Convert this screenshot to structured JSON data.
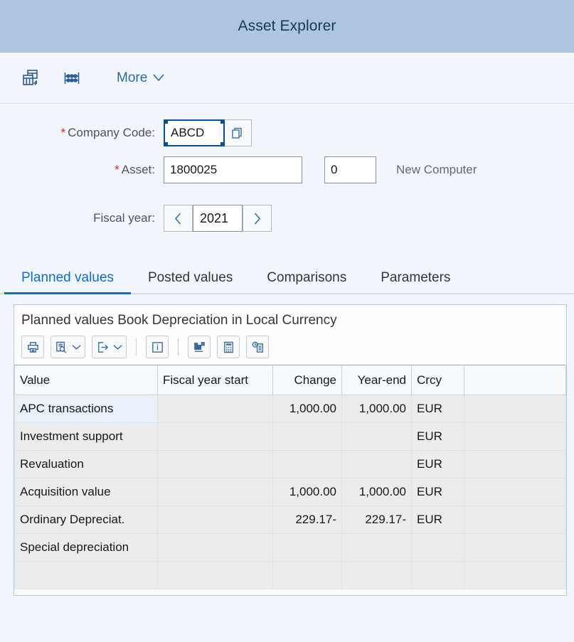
{
  "header": {
    "title": "Asset Explorer"
  },
  "toolbar": {
    "icons": [
      {
        "name": "asset-balance-icon",
        "title": "Asset Balances"
      },
      {
        "name": "abacus-depreciation-icon",
        "title": "Depreciation Calculation"
      }
    ],
    "more_label": "More",
    "more_chevron": "chevron-down-icon"
  },
  "form": {
    "company_code": {
      "label": "Company Code:",
      "required_marker": "*",
      "value": "ABCD",
      "placeholder": "",
      "value_help_icon": "copy-documents-icon"
    },
    "asset": {
      "label": "Asset:",
      "required_marker": "*",
      "value": "1800025",
      "placeholder": "",
      "subnumber_value": "0",
      "subnumber_placeholder": "",
      "description": "New Computer"
    },
    "fiscal_year": {
      "label": "Fiscal year:",
      "value": "2021",
      "placeholder": "",
      "prev_icon": "chevron-left-icon",
      "next_icon": "chevron-right-icon"
    }
  },
  "tabs": [
    {
      "label": "Planned values",
      "active": true
    },
    {
      "label": "Posted values",
      "active": false
    },
    {
      "label": "Comparisons",
      "active": false
    },
    {
      "label": "Parameters",
      "active": false
    }
  ],
  "panel": {
    "title": "Planned values Book Depreciation in Local Currency",
    "grid_toolbar": [
      {
        "name": "print-icon",
        "label": "",
        "has_dropdown": false
      },
      {
        "name": "view-settings-icon",
        "label": "",
        "has_dropdown": true
      },
      {
        "name": "export-icon",
        "label": "",
        "has_dropdown": true
      },
      {
        "name": "separator-1",
        "label": "",
        "has_dropdown": false
      },
      {
        "name": "info-icon",
        "label": "",
        "has_dropdown": false
      },
      {
        "name": "separator-2",
        "label": "",
        "has_dropdown": false
      },
      {
        "name": "chart-puzzle-icon",
        "label": "",
        "has_dropdown": false
      },
      {
        "name": "calculator-icon",
        "label": "",
        "has_dropdown": false
      },
      {
        "name": "history-list-icon",
        "label": "",
        "has_dropdown": false
      }
    ],
    "grid": {
      "columns": [
        {
          "key": "value",
          "label": "Value",
          "align": "left"
        },
        {
          "key": "fy_start",
          "label": "Fiscal year start",
          "align": "left"
        },
        {
          "key": "change",
          "label": "Change",
          "align": "right"
        },
        {
          "key": "year_end",
          "label": "Year-end",
          "align": "right"
        },
        {
          "key": "crcy",
          "label": "Crcy",
          "align": "left"
        }
      ],
      "rows": [
        {
          "value": "APC transactions",
          "fy_start": "",
          "change": "1,000.00",
          "year_end": "1,000.00",
          "crcy": "EUR",
          "highlight": "none",
          "year_end_highlight": "green",
          "first_row": true
        },
        {
          "value": "Investment support",
          "fy_start": "",
          "change": "",
          "year_end": "",
          "crcy": "EUR",
          "highlight": "none",
          "year_end_highlight": "green",
          "first_row": false
        },
        {
          "value": "Revaluation",
          "fy_start": "",
          "change": "",
          "year_end": "",
          "crcy": "EUR",
          "highlight": "none",
          "year_end_highlight": "green",
          "first_row": false
        },
        {
          "value": "Acquisition value",
          "fy_start": "",
          "change": "1,000.00",
          "year_end": "1,000.00",
          "crcy": "EUR",
          "highlight": "yellow",
          "year_end_highlight": "yellow",
          "first_row": false
        },
        {
          "value": "Ordinary Depreciat.",
          "fy_start": "",
          "change": "229.17-",
          "year_end": "229.17-",
          "crcy": "EUR",
          "highlight": "none",
          "year_end_highlight": "green",
          "first_row": false
        },
        {
          "value": "Special depreciation",
          "fy_start": "",
          "change": "",
          "year_end": "",
          "crcy": "",
          "highlight": "none",
          "year_end_highlight": "green",
          "first_row": false
        },
        {
          "value": "",
          "fy_start": "",
          "change": "",
          "year_end": "",
          "crcy": "",
          "highlight": "none",
          "year_end_highlight": "green",
          "first_row": false
        }
      ]
    }
  },
  "colors": {
    "header_bar": "#adc6de",
    "accent": "#0a6ed1",
    "highlight_green": "#c5f5c5",
    "highlight_yellow": "#fff341",
    "row_header_blue": "#ccdcec",
    "required_red": "#d62828"
  }
}
